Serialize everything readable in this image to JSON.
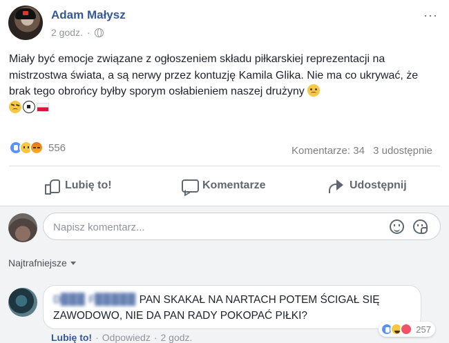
{
  "post": {
    "author": "Adam Małysz",
    "time": "2 godz.",
    "separator": "·",
    "more": "···",
    "text": "Miały być emocje związane z ogłoszeniem składu piłkarskiej reprezentacji na mistrzostwa świata, a są nerwy przez kontuzję Kamila Glika. Nie ma co ukrywać, że brak tego obrońcy byłby sporym osłabieniem naszej drużyny",
    "reaction_count": "556",
    "comments_count": "Komentarze: 34",
    "shares_count": "3 udostępnie"
  },
  "actions": {
    "like": "Lubię to!",
    "comment": "Komentarze",
    "share": "Udostępnij"
  },
  "comment_box": {
    "placeholder": "Napisz komentarz..."
  },
  "sort": {
    "label": "Najtrafniejsze"
  },
  "comment": {
    "author": "D▉▉▉ F▉▉▉▉▉",
    "text": "PAN SKAKAŁ NA NARTACH  POTEM ŚCIGAŁ SIĘ ZAWODOWO, NIE DA PAN RADY POKOPAĆ PIŁKI?",
    "reaction_count": "257",
    "like": "Lubię to!",
    "reply": "Odpowiedz",
    "separator": "·",
    "time": "2 godz."
  },
  "colors": {
    "link": "#365899",
    "muted": "#90949c",
    "background": "#f2f3f5"
  }
}
